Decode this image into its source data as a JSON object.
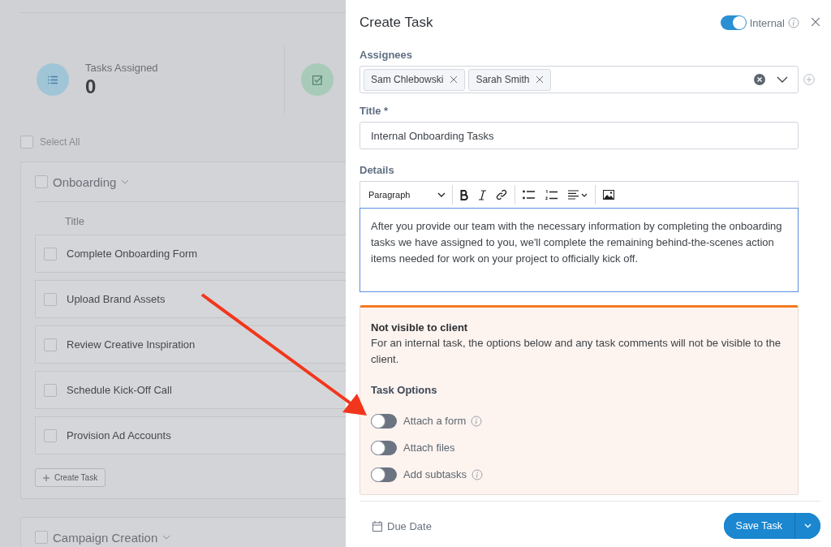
{
  "stats": [
    {
      "kind": "list",
      "label": "Tasks Assigned",
      "value": "0"
    },
    {
      "kind": "check"
    }
  ],
  "select_all": {
    "label": "Select All",
    "checked": false
  },
  "groups": [
    {
      "name": "Onboarding",
      "checked": false,
      "column": "Title",
      "tasks": [
        {
          "title": "Complete Onboarding Form",
          "checked": false
        },
        {
          "title": "Upload Brand Assets",
          "checked": false
        },
        {
          "title": "Review Creative Inspiration",
          "checked": false
        },
        {
          "title": "Schedule Kick-Off Call",
          "checked": false
        },
        {
          "title": "Provision Ad Accounts",
          "checked": false
        }
      ],
      "create_button": "Create Task"
    },
    {
      "name": "Campaign Creation",
      "checked": false
    }
  ],
  "drawer": {
    "title": "Create Task",
    "internal_toggle": {
      "label": "Internal",
      "on": true
    },
    "assignees": {
      "label": "Assignees",
      "chips": [
        "Sam Chlebowski",
        "Sarah Smith"
      ]
    },
    "title_field": {
      "label": "Title *",
      "value": "Internal Onboarding Tasks"
    },
    "details": {
      "label": "Details",
      "block_format": "Paragraph",
      "text": "After you provide our team with the necessary information by completing the onboarding tasks we have assigned to you, we'll complete the remaining behind-the-scenes action items needed for work on your project to officially kick off."
    },
    "notice": {
      "heading": "Not visible to client",
      "text": "For an internal task, the options below and any task comments will not be visible to the client."
    },
    "task_options": {
      "heading": "Task Options",
      "options": [
        {
          "label": "Attach a form",
          "on": false,
          "info": true
        },
        {
          "label": "Attach files",
          "on": false,
          "info": false
        },
        {
          "label": "Add subtasks",
          "on": false,
          "info": true
        }
      ]
    },
    "footer": {
      "due_date": "Due Date",
      "save": "Save Task"
    }
  }
}
